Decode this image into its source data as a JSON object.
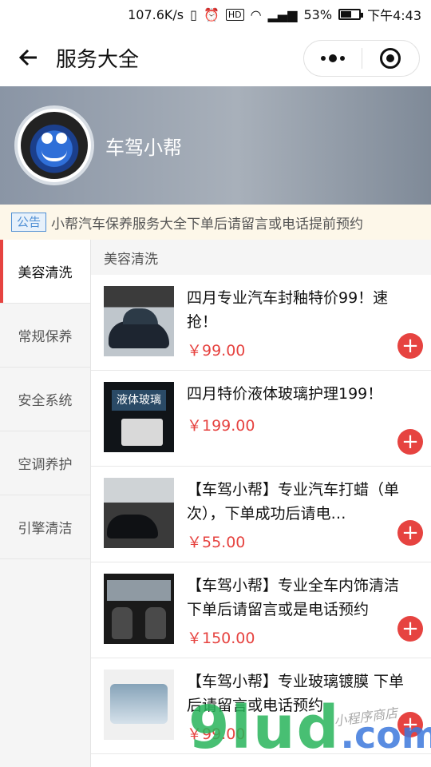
{
  "status_bar": {
    "speed": "107.6K/s",
    "battery_pct": "53%",
    "time": "下午4:43"
  },
  "nav": {
    "title": "服务大全"
  },
  "shop": {
    "name": "车驾小帮"
  },
  "notice": {
    "tag": "公告",
    "text": "小帮汽车保养服务大全下单后请留言或电话提前预约"
  },
  "categories": [
    {
      "label": "美容清洗"
    },
    {
      "label": "常规保养"
    },
    {
      "label": "安全系统"
    },
    {
      "label": "空调养护"
    },
    {
      "label": "引擎清洁"
    }
  ],
  "section": {
    "title": "美容清洗"
  },
  "products": [
    {
      "name": "四月专业汽车封釉特价99！速抢！",
      "price": "￥99.00"
    },
    {
      "name": "四月特价液体玻璃护理199！",
      "price": "￥199.00",
      "thumb_text": "液体玻璃"
    },
    {
      "name": "【车驾小帮】专业汽车打蜡（单次），下单成功后请电…",
      "price": "￥55.00"
    },
    {
      "name": "【车驾小帮】专业全车内饰清洁 下单后请留言或是电话预约",
      "price": "￥150.00"
    },
    {
      "name": "【车驾小帮】专业玻璃镀膜 下单后请留言或电话预约",
      "price": "￥99.00"
    }
  ],
  "watermark": {
    "main": "9lud",
    "suffix": ".com",
    "sub": "小程序商店"
  }
}
